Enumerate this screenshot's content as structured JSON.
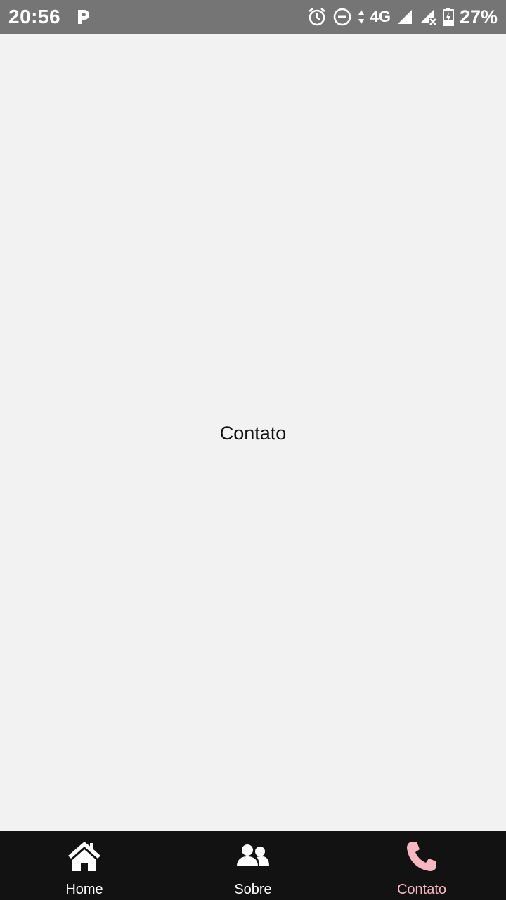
{
  "status_bar": {
    "time": "20:56",
    "network": "4G",
    "battery": "27%",
    "icons": [
      "parking-icon",
      "alarm-icon",
      "do-not-disturb-icon",
      "data-arrows-icon",
      "signal-icon",
      "signal-no-data-icon",
      "battery-charging-icon"
    ]
  },
  "main": {
    "title": "Contato"
  },
  "tabs": [
    {
      "label": "Home",
      "icon": "home-icon",
      "active": false
    },
    {
      "label": "Sobre",
      "icon": "users-icon",
      "active": false
    },
    {
      "label": "Contato",
      "icon": "phone-icon",
      "active": true
    }
  ],
  "colors": {
    "status_bar_bg": "#757575",
    "content_bg": "#f2f2f2",
    "tab_bar_bg": "#121212",
    "active_tab": "#f7b6c2",
    "inactive_tab": "#ffffff"
  }
}
